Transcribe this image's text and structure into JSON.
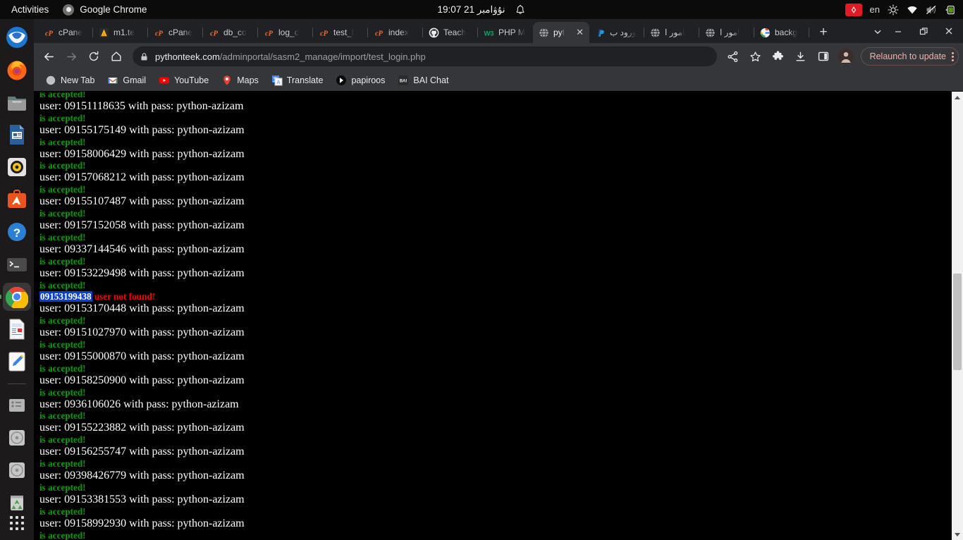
{
  "top_bar": {
    "activities": "Activities",
    "app_name": "Google Chrome",
    "clock": "نۇۋامبر 21  19:07",
    "keyboard_layout": "en",
    "icons": [
      "bell-icon",
      "red-app-indicator-icon",
      "brightness-icon",
      "wifi-icon",
      "volume-muted-icon",
      "battery-charging-icon"
    ]
  },
  "dock": {
    "items": [
      {
        "name": "thunderbird",
        "label": "Thunderbird Mail"
      },
      {
        "name": "firefox",
        "label": "Firefox Web Browser"
      },
      {
        "name": "files",
        "label": "Files"
      },
      {
        "name": "libreoffice-writer",
        "label": "LibreOffice Writer"
      },
      {
        "name": "rhythmbox",
        "label": "Rhythmbox"
      },
      {
        "name": "ubuntu-software",
        "label": "Ubuntu Software"
      },
      {
        "name": "help",
        "label": "Help"
      },
      {
        "name": "terminal",
        "label": "Terminal"
      },
      {
        "name": "google-chrome",
        "label": "Google Chrome"
      },
      {
        "name": "document-viewer",
        "label": "Document Viewer"
      },
      {
        "name": "text-editor",
        "label": "Text Editor"
      },
      {
        "name": "disks",
        "label": "Disks"
      },
      {
        "name": "cd-drive-1",
        "label": "CD Drive"
      },
      {
        "name": "cd-drive-2",
        "label": "CD Drive"
      },
      {
        "name": "trash",
        "label": "Trash"
      }
    ],
    "show_apps_label": "Show Applications"
  },
  "browser": {
    "tabs": [
      {
        "title": "cPane",
        "favicon": "cpanel-icon",
        "active": false
      },
      {
        "title": "m1.te",
        "favicon": "pycharm-icon",
        "active": false
      },
      {
        "title": "cPane",
        "favicon": "cpanel-icon",
        "active": false
      },
      {
        "title": "db_co",
        "favicon": "cpanel-icon",
        "active": false
      },
      {
        "title": "log_d",
        "favicon": "cpanel-icon",
        "active": false
      },
      {
        "title": "test_l",
        "favicon": "cpanel-icon",
        "active": false
      },
      {
        "title": "index",
        "favicon": "cpanel-icon",
        "active": false
      },
      {
        "title": "Teach",
        "favicon": "github-icon",
        "active": false
      },
      {
        "title": "PHP M",
        "favicon": "w3schools-icon",
        "active": false
      },
      {
        "title": "pyt",
        "favicon": "globe-icon",
        "active": true
      },
      {
        "title": "ورود ب",
        "favicon": "paypal-icon",
        "active": false
      },
      {
        "title": "امور ا",
        "favicon": "globe-icon",
        "active": false
      },
      {
        "title": "امور ا",
        "favicon": "globe-icon",
        "active": false
      },
      {
        "title": "backg",
        "favicon": "google-icon",
        "active": false
      }
    ],
    "new_tab_label": "+",
    "tab_search_label": "Search tabs",
    "window_controls": {
      "minimize": "—",
      "maximize": "□",
      "close": "✕"
    },
    "toolbar": {
      "back_label": "Back",
      "forward_label": "Forward",
      "reload_label": "Reload",
      "home_label": "Home",
      "url_domain": "pythonteek.com",
      "url_path": "/adminportal/sasm2_manage/import/test_login.php",
      "share_label": "Share this page",
      "bookmark_label": "Bookmark this tab",
      "extensions_label": "Extensions",
      "downloads_label": "Downloads",
      "side_panel_label": "Side panel",
      "profile_label": "Profile",
      "relaunch_label": "Relaunch to update",
      "menu_label": "Customize and control Google Chrome"
    },
    "bookmarks": [
      {
        "label": "New Tab",
        "icon": "newtab-icon"
      },
      {
        "label": "Gmail",
        "icon": "gmail-icon"
      },
      {
        "label": "YouTube",
        "icon": "youtube-icon"
      },
      {
        "label": "Maps",
        "icon": "maps-icon"
      },
      {
        "label": "Translate",
        "icon": "translate-icon"
      },
      {
        "label": "papiroos",
        "icon": "papiroos-icon"
      },
      {
        "label": "BAI Chat",
        "icon": "baichat-icon"
      }
    ]
  },
  "page": {
    "accepted_text": "is accepted!",
    "error_text": "user not found!",
    "partial_top_line": "is accepted!",
    "lines": [
      {
        "type": "user",
        "text": "user: 09151118635 with pass: python-azizam"
      },
      {
        "type": "ok",
        "text": "is accepted!"
      },
      {
        "type": "user",
        "text": "user: 09155175149 with pass: python-azizam"
      },
      {
        "type": "ok",
        "text": "is accepted!"
      },
      {
        "type": "user",
        "text": "user: 09158006429 with pass: python-azizam"
      },
      {
        "type": "ok",
        "text": "is accepted!"
      },
      {
        "type": "user",
        "text": "user: 09157068212 with pass: python-azizam"
      },
      {
        "type": "ok",
        "text": "is accepted!"
      },
      {
        "type": "user",
        "text": "user: 09155107487 with pass: python-azizam"
      },
      {
        "type": "ok",
        "text": "is accepted!"
      },
      {
        "type": "user",
        "text": "user: 09157152058 with pass: python-azizam"
      },
      {
        "type": "ok",
        "text": "is accepted!"
      },
      {
        "type": "user",
        "text": "user: 09337144546 with pass: python-azizam"
      },
      {
        "type": "ok",
        "text": "is accepted!"
      },
      {
        "type": "user",
        "text": "user: 09153229498 with pass: python-azizam"
      },
      {
        "type": "ok",
        "text": "is accepted!"
      },
      {
        "type": "error",
        "number": "09153199438",
        "message": "user not found!"
      },
      {
        "type": "user",
        "text": "user: 09153170448 with pass: python-azizam"
      },
      {
        "type": "ok",
        "text": "is accepted!"
      },
      {
        "type": "user",
        "text": "user: 09151027970 with pass: python-azizam"
      },
      {
        "type": "ok",
        "text": "is accepted!"
      },
      {
        "type": "user",
        "text": "user: 09155000870 with pass: python-azizam"
      },
      {
        "type": "ok",
        "text": "is accepted!"
      },
      {
        "type": "user",
        "text": "user: 09158250900 with pass: python-azizam"
      },
      {
        "type": "ok",
        "text": "is accepted!"
      },
      {
        "type": "user",
        "text": "user: 0936106026 with pass: python-azizam"
      },
      {
        "type": "ok",
        "text": "is accepted!"
      },
      {
        "type": "user",
        "text": "user: 09155223882 with pass: python-azizam"
      },
      {
        "type": "ok",
        "text": "is accepted!"
      },
      {
        "type": "user",
        "text": "user: 09156255747 with pass: python-azizam"
      },
      {
        "type": "ok",
        "text": "is accepted!"
      },
      {
        "type": "user",
        "text": "user: 09398426779 with pass: python-azizam"
      },
      {
        "type": "ok",
        "text": "is accepted!"
      },
      {
        "type": "user",
        "text": "user: 09153381553 with pass: python-azizam"
      },
      {
        "type": "ok",
        "text": "is accepted!"
      },
      {
        "type": "user",
        "text": "user: 09158992930 with pass: python-azizam"
      },
      {
        "type": "ok",
        "text": "is accepted!"
      }
    ]
  },
  "colors": {
    "accepted_green": "#00a000",
    "error_red": "#ff0000",
    "selection_blue": "#0b41cd",
    "page_bg": "#000000",
    "chrome_toolbar": "#35363a",
    "relaunch_pink": "#f6aea9"
  }
}
